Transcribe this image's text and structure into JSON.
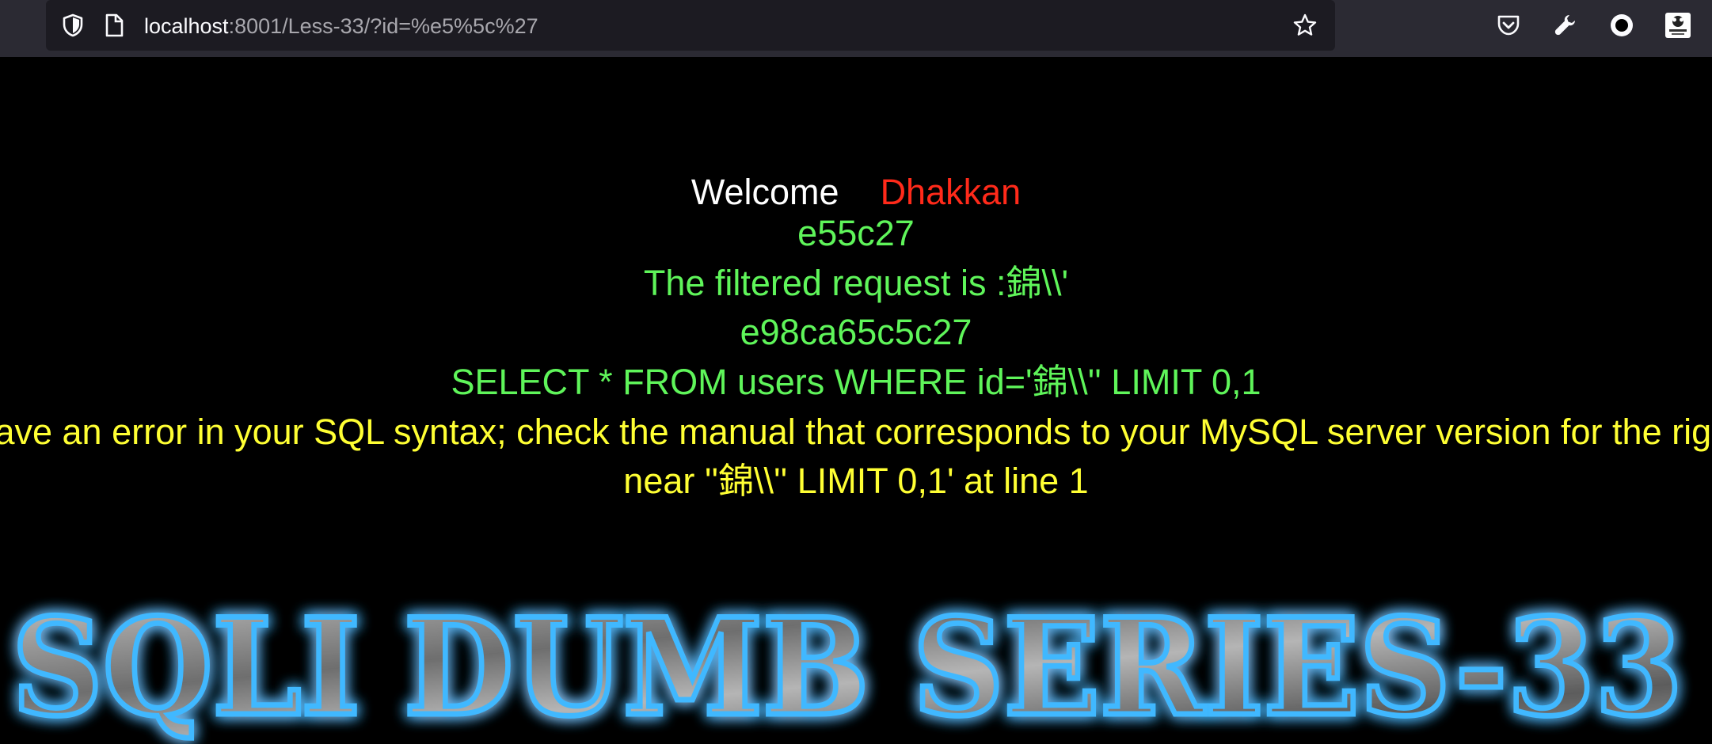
{
  "browser": {
    "url_host": "localhost",
    "url_rest": ":8001/Less-33/?id=%e5%5c%27",
    "icons": [
      "shield-icon",
      "page-icon",
      "star-icon",
      "pocket-icon",
      "wrench-icon",
      "account-icon",
      "extension-icon"
    ]
  },
  "page": {
    "welcome_label": "Welcome",
    "user_name": "Dhakkan",
    "hex_input": "e55c27",
    "filtered_request": "The filtered request is :錦\\\\'",
    "hex_filtered": "e98ca65c5c27",
    "sql_query": "SELECT * FROM users WHERE id='錦\\\\'' LIMIT 0,1",
    "error_line1": "You have an error in your SQL syntax; check the manual that corresponds to your MySQL server version for the right syntax to use",
    "error_line2": "near ''錦\\\\'' LIMIT 0,1' at line 1",
    "banner_text": "SQLI DUMB SERIES-33"
  },
  "colors": {
    "toolbar_bg": "#2b2a33",
    "urlbar_bg": "#1c1b22",
    "page_bg": "#000000",
    "welcome": "#ffffff",
    "name": "#ff2a1a",
    "green_text": "#5ff55a",
    "yellow_text": "#ffff33",
    "banner_glow": "#3fb8ff"
  }
}
